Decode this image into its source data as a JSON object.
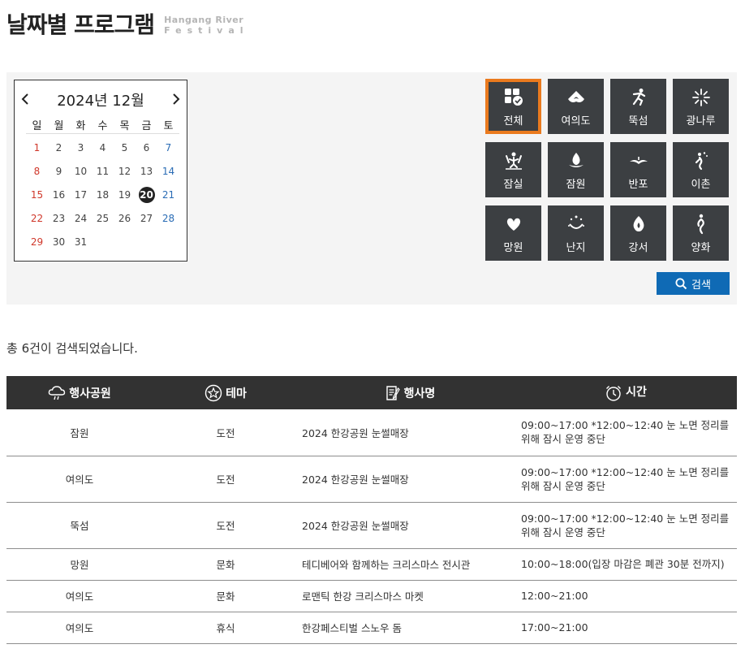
{
  "header": {
    "title": "날짜별 프로그램",
    "logo_line1": "Hangang River",
    "logo_line2": "Festival"
  },
  "calendar": {
    "month_label": "2024년 12월",
    "weekdays": [
      "일",
      "월",
      "화",
      "수",
      "목",
      "금",
      "토"
    ],
    "weeks": [
      [
        "1",
        "2",
        "3",
        "4",
        "5",
        "6",
        "7"
      ],
      [
        "8",
        "9",
        "10",
        "11",
        "12",
        "13",
        "14"
      ],
      [
        "15",
        "16",
        "17",
        "18",
        "19",
        "20",
        "21"
      ],
      [
        "22",
        "23",
        "24",
        "25",
        "26",
        "27",
        "28"
      ],
      [
        "29",
        "30",
        "31",
        "",
        "",
        "",
        ""
      ]
    ],
    "selected_day": "20"
  },
  "parks": [
    {
      "label": "전체",
      "icon": "grid-check-icon",
      "active": true
    },
    {
      "label": "여의도",
      "icon": "yeouido-icon",
      "active": false
    },
    {
      "label": "뚝섬",
      "icon": "ttukseom-icon",
      "active": false
    },
    {
      "label": "광나루",
      "icon": "gwangnaru-icon",
      "active": false
    },
    {
      "label": "잠실",
      "icon": "jamsil-icon",
      "active": false
    },
    {
      "label": "잠원",
      "icon": "jamwon-icon",
      "active": false
    },
    {
      "label": "반포",
      "icon": "banpo-icon",
      "active": false
    },
    {
      "label": "이촌",
      "icon": "ichon-icon",
      "active": false
    },
    {
      "label": "망원",
      "icon": "mangwon-icon",
      "active": false
    },
    {
      "label": "난지",
      "icon": "nanji-icon",
      "active": false
    },
    {
      "label": "강서",
      "icon": "gangseo-icon",
      "active": false
    },
    {
      "label": "양화",
      "icon": "yanghwa-icon",
      "active": false
    }
  ],
  "search_button": "검색",
  "result_count": "총 6건이 검색되었습니다.",
  "table": {
    "headers": {
      "park": "행사공원",
      "theme": "테마",
      "name": "행사명",
      "time": "시간"
    },
    "rows": [
      {
        "park": "잠원",
        "theme": "도전",
        "name": "2024 한강공원 눈썰매장",
        "time": "09:00~17:00 *12:00~12:40 눈 노면 정리를 위해 잠시 운영 중단"
      },
      {
        "park": "여의도",
        "theme": "도전",
        "name": "2024 한강공원 눈썰매장",
        "time": "09:00~17:00 *12:00~12:40 눈 노면 정리를 위해 잠시 운영 중단"
      },
      {
        "park": "뚝섬",
        "theme": "도전",
        "name": "2024 한강공원 눈썰매장",
        "time": "09:00~17:00 *12:00~12:40 눈 노면 정리를 위해 잠시 운영 중단"
      },
      {
        "park": "망원",
        "theme": "문화",
        "name": "테디베어와 함께하는 크리스마스 전시관",
        "time": "10:00~18:00(입장 마감은 폐관 30분 전까지)"
      },
      {
        "park": "여의도",
        "theme": "문화",
        "name": "로맨틱 한강 크리스마스 마켓",
        "time": "12:00~21:00"
      },
      {
        "park": "여의도",
        "theme": "휴식",
        "name": "한강페스티벌 스노우 돔",
        "time": "17:00~21:00"
      }
    ]
  },
  "colors": {
    "accent_orange": "#ea7a1e",
    "button_blue": "#0f6ab5",
    "tile_dark": "#3c3f42",
    "header_dark": "#323232",
    "sunday_red": "#d0382b",
    "saturday_blue": "#2a6cb5"
  }
}
